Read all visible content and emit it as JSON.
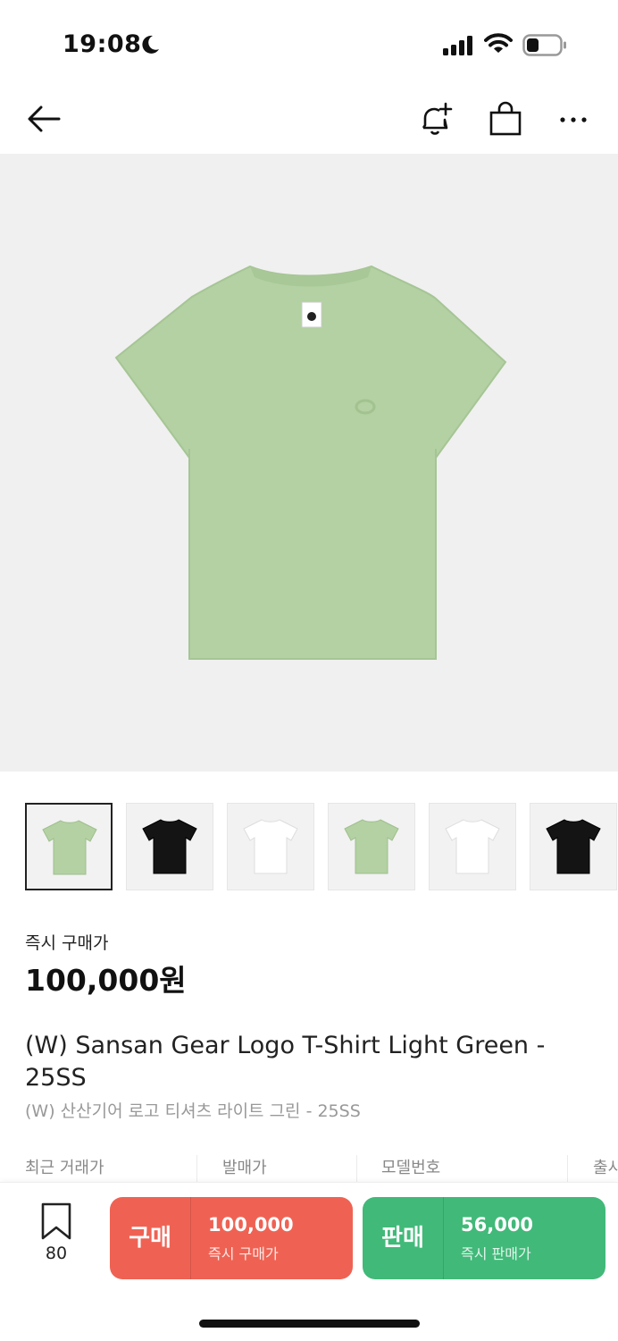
{
  "status_bar": {
    "time": "19:08"
  },
  "nav": {
    "icons": [
      "back-arrow-icon",
      "bell-plus-icon",
      "shopping-bag-icon",
      "more-icon"
    ]
  },
  "hero": {
    "image": "light green t-shirt product photo",
    "shirt_color": "#b3d1a2",
    "background": "#f0f0f0"
  },
  "thumbnails": [
    {
      "color": "#b3d1a2",
      "selected": true
    },
    {
      "color": "#141414",
      "selected": false
    },
    {
      "color": "#ffffff",
      "selected": false
    },
    {
      "color": "#b3d1a2",
      "selected": false
    },
    {
      "color": "#ffffff",
      "selected": false
    },
    {
      "color": "#141414",
      "selected": false
    }
  ],
  "price": {
    "label": "즉시 구매가",
    "value": "100,000원"
  },
  "product": {
    "title": "(W) Sansan Gear Logo T-Shirt Light Green - 25SS",
    "subtitle": "(W) 산산기어 로고 티셔츠 라이트 그린 - 25SS"
  },
  "info_row": [
    "최근 거래가",
    "발매가",
    "모델번호",
    "출시"
  ],
  "bottom_bar": {
    "wish_count": "80",
    "buy": {
      "label": "구매",
      "price": "100,000",
      "sub": "즉시 구매가",
      "color": "#ef6253"
    },
    "sell": {
      "label": "판매",
      "price": "56,000",
      "sub": "즉시 판매가",
      "color": "#41b979"
    }
  }
}
